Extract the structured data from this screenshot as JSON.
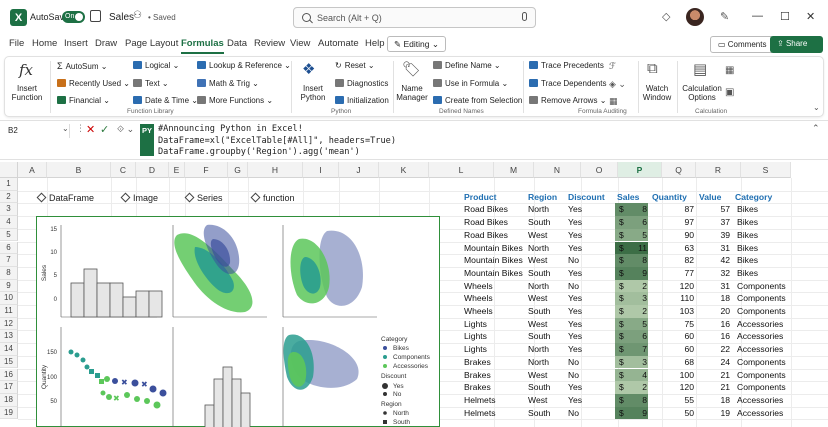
{
  "titlebar": {
    "app_logo": "X",
    "autosave_label": "AutoSave",
    "autosave_state": "On",
    "doc_name": "Sales",
    "saved_status": "• Saved",
    "search_placeholder": "Search (Alt + Q)",
    "icons": [
      "save-icon",
      "people-icon",
      "mic-icon",
      "diamond-icon",
      "pen-icon",
      "minimize-icon",
      "restore-icon",
      "close-icon"
    ]
  },
  "menu": {
    "tabs": [
      "File",
      "Home",
      "Insert",
      "Draw",
      "Page Layout",
      "Formulas",
      "Data",
      "Review",
      "View",
      "Automate",
      "Help"
    ],
    "active_tab": "Formulas",
    "editing_label": "Editing",
    "comments_label": "Comments",
    "share_label": "Share"
  },
  "ribbon": {
    "insert_function": "Insert Function",
    "autosum": "AutoSum",
    "recently_used": "Recently Used",
    "financial": "Financial",
    "logical": "Logical",
    "text": "Text",
    "date_time": "Date & Time",
    "lookup_reference": "Lookup & Reference",
    "math_trig": "Math & Trig",
    "more_functions": "More Functions",
    "function_library": "Function Library",
    "insert_python": "Insert Python",
    "reset": "Reset",
    "diagnostics": "Diagnostics",
    "initialization": "Initialization",
    "python_group": "Python",
    "name_manager": "Name Manager",
    "define_name": "Define Name",
    "use_in_formula": "Use in Formula",
    "create_from_selection": "Create from Selection",
    "defined_names": "Defined Names",
    "trace_precedents": "Trace Precedents",
    "trace_dependents": "Trace Dependents",
    "remove_arrows": "Remove Arrows",
    "formula_auditing": "Formula Auditing",
    "watch_window": "Watch Window",
    "calculation_options": "Calculation Options",
    "calculation_group": "Calculation"
  },
  "formula_bar": {
    "cell_ref": "B2",
    "py_badge": "PY",
    "code_lines": [
      "#Announcing Python in Excel!",
      "DataFrame=xl(\"ExcelTable[#All]\", headers=True)",
      "DataFrame.groupby('Region').agg('mean')"
    ]
  },
  "grid": {
    "columns": [
      "A",
      "B",
      "C",
      "D",
      "E",
      "F",
      "G",
      "H",
      "I",
      "J",
      "K",
      "L",
      "M",
      "N",
      "O",
      "P",
      "Q",
      "R",
      "S"
    ],
    "selected_column": "P",
    "rows": [
      "1",
      "2",
      "3",
      "4",
      "5",
      "6",
      "7",
      "8",
      "9",
      "10",
      "11",
      "12",
      "13",
      "14",
      "15",
      "16",
      "17",
      "18",
      "19"
    ],
    "py_objects": [
      "DataFrame",
      "Image",
      "Series",
      "function"
    ],
    "table_headers": [
      "Product",
      "Region",
      "Discount",
      "Sales",
      "Quantity",
      "Value",
      "Category"
    ],
    "table_rows": [
      [
        "Road Bikes",
        "North",
        "Yes",
        "$",
        "8",
        "87",
        "57",
        "Bikes"
      ],
      [
        "Road Bikes",
        "South",
        "Yes",
        "$",
        "6",
        "97",
        "37",
        "Bikes"
      ],
      [
        "Road Bikes",
        "West",
        "Yes",
        "$",
        "5",
        "90",
        "39",
        "Bikes"
      ],
      [
        "Mountain Bikes",
        "North",
        "Yes",
        "$",
        "11",
        "63",
        "31",
        "Bikes"
      ],
      [
        "Mountain Bikes",
        "West",
        "No",
        "$",
        "8",
        "82",
        "42",
        "Bikes"
      ],
      [
        "Mountain Bikes",
        "South",
        "Yes",
        "$",
        "9",
        "77",
        "32",
        "Bikes"
      ],
      [
        "Wheels",
        "North",
        "No",
        "$",
        "2",
        "120",
        "31",
        "Components"
      ],
      [
        "Wheels",
        "West",
        "Yes",
        "$",
        "3",
        "110",
        "18",
        "Components"
      ],
      [
        "Wheels",
        "South",
        "Yes",
        "$",
        "2",
        "103",
        "20",
        "Components"
      ],
      [
        "Lights",
        "West",
        "Yes",
        "$",
        "5",
        "75",
        "16",
        "Accessories"
      ],
      [
        "Lights",
        "South",
        "Yes",
        "$",
        "6",
        "60",
        "16",
        "Accessories"
      ],
      [
        "Lights",
        "North",
        "Yes",
        "$",
        "7",
        "60",
        "22",
        "Accessories"
      ],
      [
        "Brakes",
        "North",
        "No",
        "$",
        "3",
        "68",
        "24",
        "Components"
      ],
      [
        "Brakes",
        "West",
        "No",
        "$",
        "4",
        "100",
        "21",
        "Components"
      ],
      [
        "Brakes",
        "South",
        "Yes",
        "$",
        "2",
        "120",
        "21",
        "Components"
      ],
      [
        "Helmets",
        "West",
        "Yes",
        "$",
        "8",
        "55",
        "18",
        "Accessories"
      ],
      [
        "Helmets",
        "South",
        "No",
        "$",
        "9",
        "50",
        "19",
        "Accessories"
      ]
    ]
  },
  "plot": {
    "y_label_top": "Sales",
    "y_label_bottom": "Quantity",
    "y_ticks_top": [
      "15",
      "10",
      "5",
      "0"
    ],
    "y_ticks_bottom": [
      "150",
      "100",
      "50"
    ],
    "legend": {
      "category_title": "Category",
      "categories": [
        "Bikes",
        "Components",
        "Accessories"
      ],
      "discount_title": "Discount",
      "discount_values": [
        "Yes",
        "No"
      ],
      "region_title": "Region",
      "region_values": [
        "North",
        "South"
      ]
    },
    "colors": {
      "bikes": "#3b4f9c",
      "components": "#2a9d8f",
      "accessories": "#5cc75a"
    }
  }
}
